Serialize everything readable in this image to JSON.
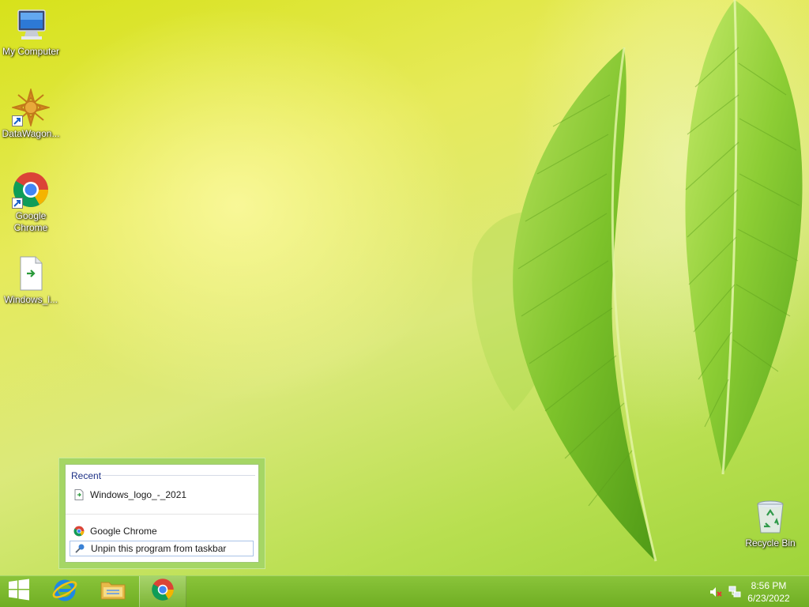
{
  "desktop": {
    "icons": [
      {
        "label": "My Computer",
        "icon": "my-computer-icon"
      },
      {
        "label": "DataWagon...",
        "icon": "datawagon-icon"
      },
      {
        "label": "Google Chrome",
        "icon": "chrome-icon"
      },
      {
        "label": "Windows_l...",
        "icon": "file-icon"
      },
      {
        "label": "Recycle Bin",
        "icon": "recycle-bin-icon"
      }
    ]
  },
  "jumplist": {
    "heading": "Recent",
    "recent_items": [
      {
        "label": "Windows_logo_-_2021",
        "icon": "file-icon"
      }
    ],
    "tasks": [
      {
        "label": "Google Chrome",
        "icon": "chrome-icon"
      },
      {
        "label": "Unpin this program from taskbar",
        "icon": "unpin-icon"
      }
    ]
  },
  "taskbar": {
    "buttons": [
      {
        "icon": "windows-start-icon"
      },
      {
        "icon": "internet-explorer-icon"
      },
      {
        "icon": "file-explorer-icon"
      },
      {
        "icon": "chrome-icon",
        "active": true
      }
    ],
    "tray": [
      {
        "icon": "speaker-muted-icon"
      },
      {
        "icon": "network-icon"
      }
    ],
    "clock": {
      "time": "8:56 PM",
      "date": "6/23/2022"
    }
  },
  "colors": {
    "taskbar": "#7ab82e",
    "jumplist_frame": "#a5d665",
    "jumplist_heading": "#1e3287"
  }
}
